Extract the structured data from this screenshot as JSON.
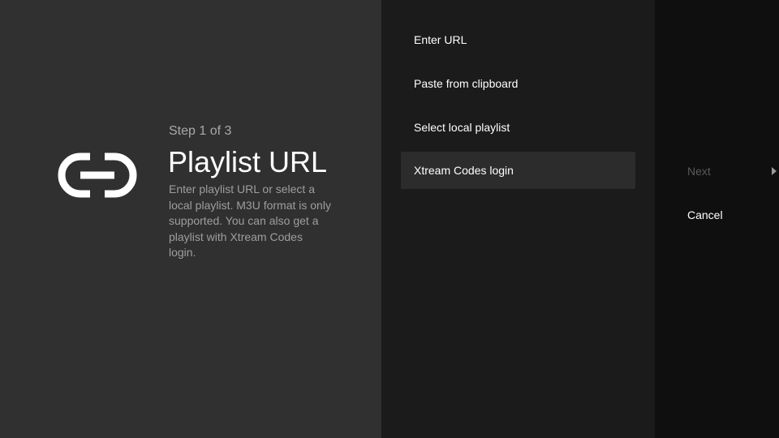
{
  "guidance": {
    "icon": "link-icon",
    "breadcrumb": "Step 1 of 3",
    "title": "Playlist URL",
    "description": "Enter playlist URL or select a local playlist. M3U format is only supported. You can also get a playlist with Xtream Codes login."
  },
  "actions": [
    {
      "label": "Enter URL"
    },
    {
      "label": "Paste from clipboard"
    },
    {
      "label": "Select local playlist"
    },
    {
      "label": "Xtream Codes login",
      "focused": true
    }
  ],
  "buttons": {
    "next": {
      "label": "Next",
      "enabled": false,
      "icon": "arrow-right-icon"
    },
    "cancel": {
      "label": "Cancel",
      "enabled": true
    }
  },
  "colors": {
    "guidance_bg": "#303030",
    "actions_bg": "#1b1b1b",
    "buttons_bg": "#0f0f0f",
    "focused_item_bg": "#2c2c2c",
    "text_primary": "#ffffff",
    "text_secondary": "#9e9e9e",
    "text_disabled": "#5a5a5a"
  }
}
